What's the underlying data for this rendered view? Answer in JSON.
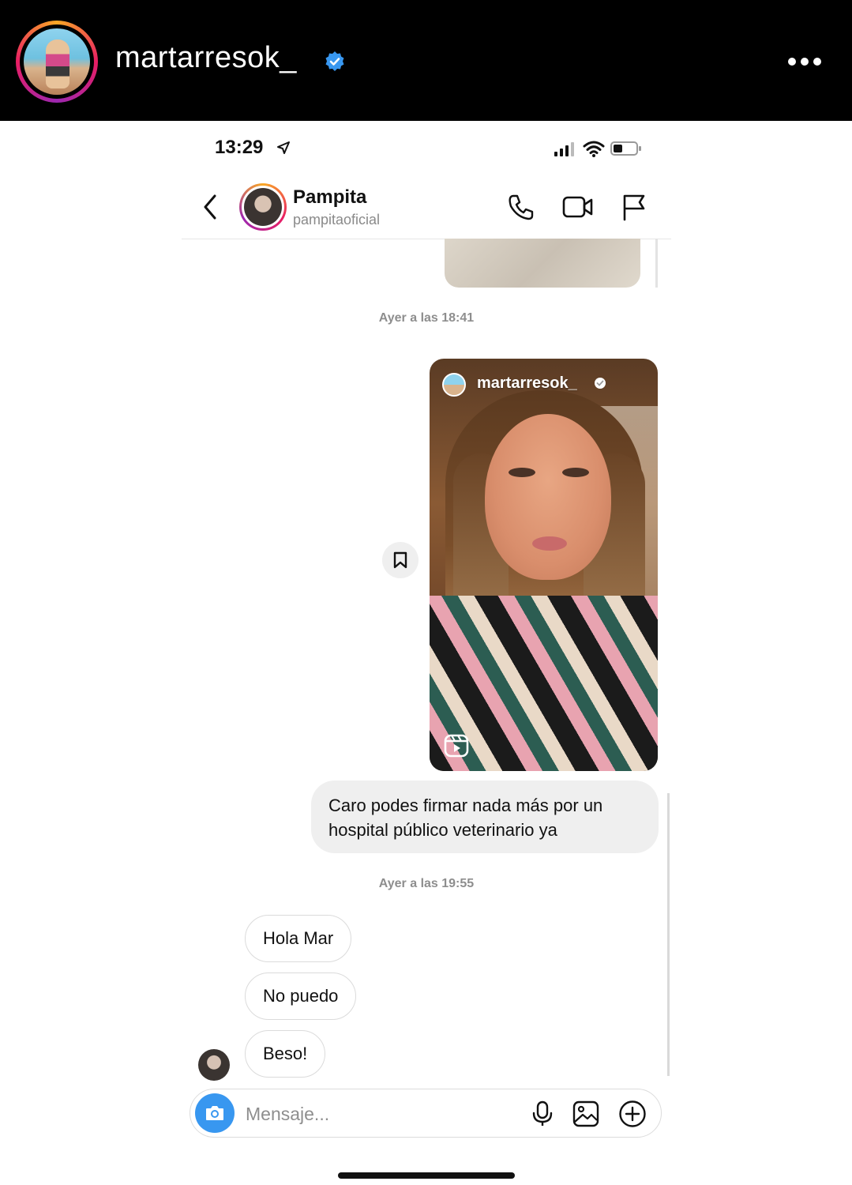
{
  "story_header": {
    "username": "martarresok_",
    "verified_icon": "verified-badge-icon",
    "more_icon": "more-options-icon"
  },
  "status_bar": {
    "time": "13:29"
  },
  "chat": {
    "contact_name": "Pampita",
    "contact_handle": "pampitaoficial"
  },
  "messages": {
    "timestamp_1": "Ayer a las 18:41",
    "shared_story_username": "martarresok_",
    "outgoing_text": "Caro podes firmar nada más por un hospital público veterinario ya",
    "timestamp_2": "Ayer a las 19:55",
    "incoming": [
      "Hola Mar",
      "No puedo",
      "Beso!"
    ]
  },
  "composer": {
    "placeholder": "Mensaje..."
  },
  "colors": {
    "accent_blue": "#3897f0",
    "verified_blue": "#3897f0",
    "header_black": "#000000"
  }
}
